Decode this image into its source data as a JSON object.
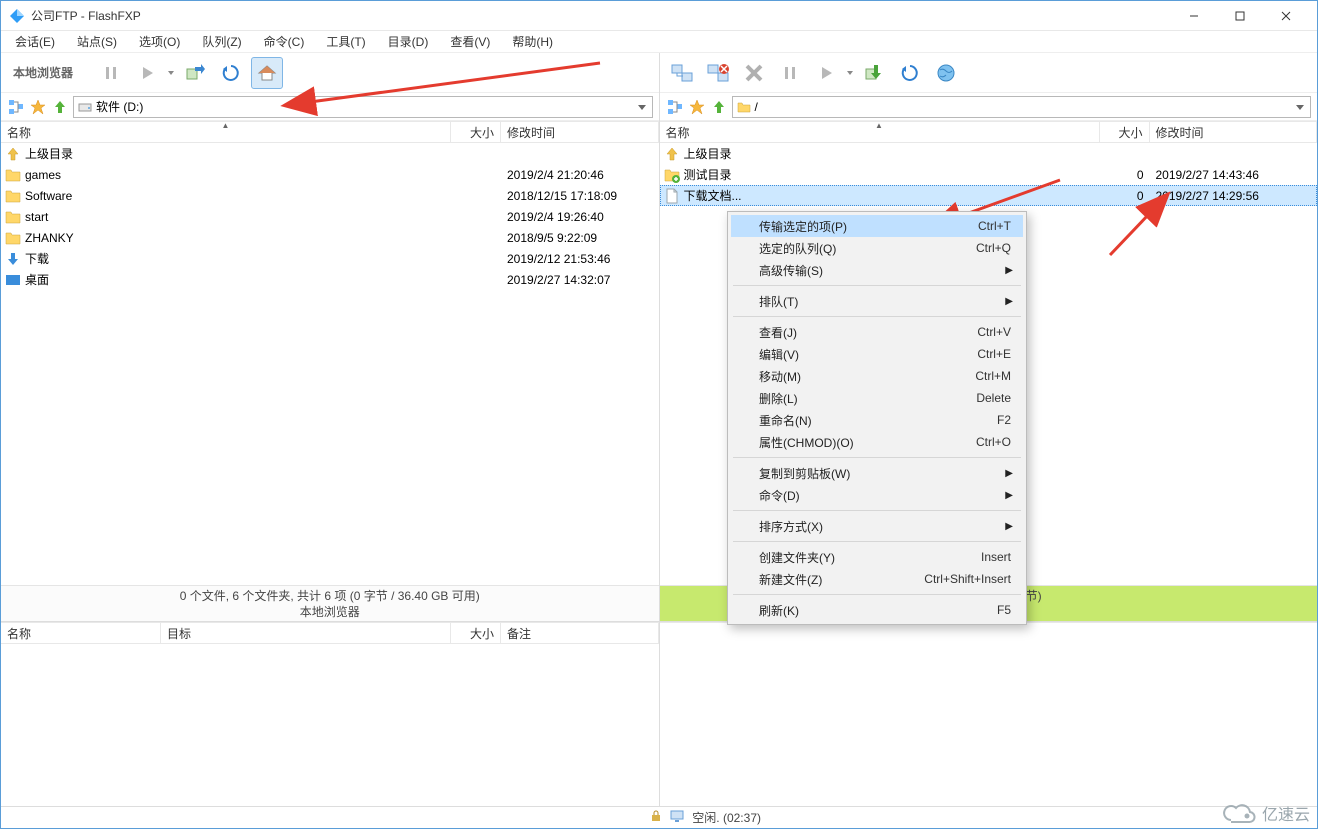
{
  "window": {
    "title": "公司FTP - FlashFXP"
  },
  "menu": [
    "会话(E)",
    "站点(S)",
    "选项(O)",
    "队列(Z)",
    "命令(C)",
    "工具(T)",
    "目录(D)",
    "查看(V)",
    "帮助(H)"
  ],
  "left": {
    "toolbar_label": "本地浏览器",
    "path": "软件 (D:)",
    "columns": {
      "name": "名称",
      "size": "大小",
      "mtime": "修改时间"
    },
    "rows": [
      {
        "icon": "up",
        "name": "上级目录",
        "size": "",
        "mtime": ""
      },
      {
        "icon": "folder",
        "name": "games",
        "size": "",
        "mtime": "2019/2/4 21:20:46"
      },
      {
        "icon": "folder",
        "name": "Software",
        "size": "",
        "mtime": "2018/12/15 17:18:09"
      },
      {
        "icon": "folder",
        "name": "start",
        "size": "",
        "mtime": "2019/2/4 19:26:40"
      },
      {
        "icon": "folder",
        "name": "ZHANKY",
        "size": "",
        "mtime": "2018/9/5 9:22:09"
      },
      {
        "icon": "down",
        "name": "下载",
        "size": "",
        "mtime": "2019/2/12 21:53:46"
      },
      {
        "icon": "desktop",
        "name": "桌面",
        "size": "",
        "mtime": "2019/2/27 14:32:07"
      }
    ],
    "status1": "0 个文件, 6 个文件夹, 共计 6 项 (0 字节 / 36.40 GB 可用)",
    "status2": "本地浏览器"
  },
  "right": {
    "path": "/",
    "columns": {
      "name": "名称",
      "size": "大小",
      "mtime": "修改时间"
    },
    "rows": [
      {
        "icon": "up",
        "name": "上级目录",
        "size": "",
        "mtime": ""
      },
      {
        "icon": "folder+",
        "name": "测试目录",
        "size": "0",
        "mtime": "2019/2/27 14:43:46"
      },
      {
        "icon": "file",
        "name": "下载文档...",
        "size": "0",
        "mtime": "2019/2/27 14:29:56",
        "selected": true
      }
    ],
    "status1": "已选定 1 项 (0 字节)"
  },
  "queue": {
    "columns": {
      "name": "名称",
      "target": "目标",
      "size": "大小",
      "note": "备注"
    }
  },
  "footer": {
    "status": "空闲. (02:37)"
  },
  "context_menu": [
    {
      "label": "传输选定的项(P)",
      "shortcut": "Ctrl+T",
      "hl": true
    },
    {
      "label": "选定的队列(Q)",
      "shortcut": "Ctrl+Q"
    },
    {
      "label": "高级传输(S)",
      "submenu": true
    },
    {
      "sep": true
    },
    {
      "label": "排队(T)",
      "submenu": true
    },
    {
      "sep": true
    },
    {
      "label": "查看(J)",
      "shortcut": "Ctrl+V"
    },
    {
      "label": "编辑(V)",
      "shortcut": "Ctrl+E"
    },
    {
      "label": "移动(M)",
      "shortcut": "Ctrl+M"
    },
    {
      "label": "删除(L)",
      "shortcut": "Delete"
    },
    {
      "label": "重命名(N)",
      "shortcut": "F2"
    },
    {
      "label": "属性(CHMOD)(O)",
      "shortcut": "Ctrl+O"
    },
    {
      "sep": true
    },
    {
      "label": "复制到剪贴板(W)",
      "submenu": true
    },
    {
      "label": "命令(D)",
      "submenu": true
    },
    {
      "sep": true
    },
    {
      "label": "排序方式(X)",
      "submenu": true
    },
    {
      "sep": true
    },
    {
      "label": "创建文件夹(Y)",
      "shortcut": "Insert"
    },
    {
      "label": "新建文件(Z)",
      "shortcut": "Ctrl+Shift+Insert"
    },
    {
      "sep": true
    },
    {
      "label": "刷新(K)",
      "shortcut": "F5"
    }
  ],
  "watermark": "亿速云"
}
